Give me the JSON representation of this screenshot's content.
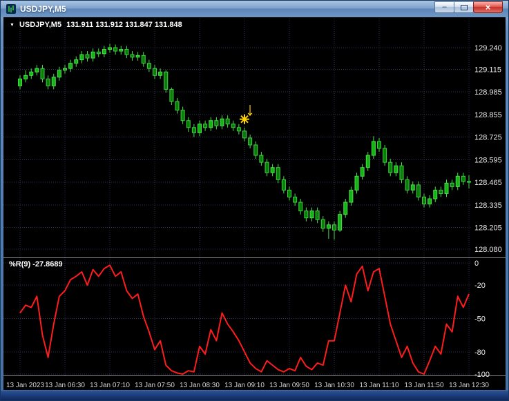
{
  "window": {
    "title": "USDJPY,M5",
    "controls": {
      "minimize_glyph": "–",
      "close_glyph": "×"
    }
  },
  "chart_data": {
    "type": "candlestick",
    "symbol": "USDJPY",
    "timeframe": "M5",
    "header": {
      "collapser_glyph": "▼",
      "symbol_period": "USDJPY,M5",
      "ohlc": "131.911 131.912 131.847 131.848"
    },
    "colors": {
      "background": "#000000",
      "grid": "#32325a",
      "candle_up": "#16b216",
      "candle_down": "#0b7d0b",
      "candle_outline": "#4ade4a",
      "indicator_line": "#ff1c1c",
      "annotation": "#ffd400"
    },
    "price_ticks": [
      129.24,
      129.115,
      128.985,
      128.855,
      128.725,
      128.595,
      128.465,
      128.335,
      128.205,
      128.08
    ],
    "time_labels": [
      {
        "text": "13 Jan 2023",
        "bar": 0
      },
      {
        "text": "13 Jan 06:30",
        "bar": 8
      },
      {
        "text": "13 Jan 07:10",
        "bar": 16
      },
      {
        "text": "13 Jan 07:50",
        "bar": 24
      },
      {
        "text": "13 Jan 08:30",
        "bar": 32
      },
      {
        "text": "13 Jan 09:10",
        "bar": 40
      },
      {
        "text": "13 Jan 09:50",
        "bar": 48
      },
      {
        "text": "13 Jan 10:30",
        "bar": 56
      },
      {
        "text": "13 Jan 11:10",
        "bar": 64
      },
      {
        "text": "13 Jan 11:50",
        "bar": 72
      },
      {
        "text": "13 Jan 12:30",
        "bar": 80
      }
    ],
    "candles": [
      [
        129.02,
        129.08,
        129.0,
        129.06
      ],
      [
        129.06,
        129.11,
        129.04,
        129.08
      ],
      [
        129.08,
        129.12,
        129.06,
        129.1
      ],
      [
        129.1,
        129.14,
        129.08,
        129.12
      ],
      [
        129.12,
        129.14,
        129.04,
        129.06
      ],
      [
        129.06,
        129.08,
        129.0,
        129.02
      ],
      [
        129.02,
        129.09,
        129.0,
        129.07
      ],
      [
        129.07,
        129.13,
        129.05,
        129.11
      ],
      [
        129.11,
        129.14,
        129.09,
        129.12
      ],
      [
        129.12,
        129.17,
        129.1,
        129.15
      ],
      [
        129.15,
        129.19,
        129.13,
        129.17
      ],
      [
        129.17,
        129.22,
        129.15,
        129.2
      ],
      [
        129.2,
        129.22,
        129.16,
        129.18
      ],
      [
        129.18,
        129.235,
        129.16,
        129.215
      ],
      [
        129.215,
        129.235,
        129.185,
        129.205
      ],
      [
        129.205,
        129.25,
        129.185,
        129.23
      ],
      [
        129.23,
        129.262,
        129.21,
        129.24
      ],
      [
        129.24,
        129.258,
        129.2,
        129.22
      ],
      [
        129.22,
        129.25,
        129.2,
        129.23
      ],
      [
        129.23,
        129.25,
        129.18,
        129.2
      ],
      [
        129.2,
        129.22,
        129.165,
        129.185
      ],
      [
        129.185,
        129.215,
        129.165,
        129.195
      ],
      [
        129.195,
        129.215,
        129.13,
        129.15
      ],
      [
        129.15,
        129.17,
        129.1,
        129.12
      ],
      [
        129.12,
        129.14,
        129.06,
        129.08
      ],
      [
        129.08,
        129.12,
        129.06,
        129.1
      ],
      [
        129.1,
        129.11,
        128.98,
        129.0
      ],
      [
        129.0,
        129.01,
        128.91,
        128.93
      ],
      [
        128.93,
        128.95,
        128.86,
        128.88
      ],
      [
        128.88,
        128.9,
        128.8,
        128.82
      ],
      [
        128.82,
        128.84,
        128.755,
        128.78
      ],
      [
        128.78,
        128.8,
        128.725,
        128.75
      ],
      [
        128.75,
        128.82,
        128.73,
        128.8
      ],
      [
        128.8,
        128.82,
        128.76,
        128.78
      ],
      [
        128.78,
        128.84,
        128.76,
        128.82
      ],
      [
        128.82,
        128.84,
        128.77,
        128.79
      ],
      [
        128.79,
        128.85,
        128.77,
        128.83
      ],
      [
        128.83,
        128.85,
        128.78,
        128.8
      ],
      [
        128.8,
        128.82,
        128.76,
        128.78
      ],
      [
        128.78,
        128.8,
        128.74,
        128.76
      ],
      [
        128.76,
        128.78,
        128.7,
        128.72
      ],
      [
        128.72,
        128.74,
        128.66,
        128.68
      ],
      [
        128.68,
        128.7,
        128.6,
        128.62
      ],
      [
        128.62,
        128.64,
        128.56,
        128.58
      ],
      [
        128.58,
        128.6,
        128.5,
        128.52
      ],
      [
        128.52,
        128.57,
        128.5,
        128.55
      ],
      [
        128.55,
        128.57,
        128.46,
        128.48
      ],
      [
        128.48,
        128.5,
        128.4,
        128.42
      ],
      [
        128.42,
        128.44,
        128.36,
        128.38
      ],
      [
        128.38,
        128.4,
        128.33,
        128.35
      ],
      [
        128.35,
        128.37,
        128.28,
        128.3
      ],
      [
        128.3,
        128.32,
        128.24,
        128.26
      ],
      [
        128.26,
        128.32,
        128.24,
        128.3
      ],
      [
        128.3,
        128.32,
        128.23,
        128.25
      ],
      [
        128.25,
        128.27,
        128.18,
        128.2
      ],
      [
        128.2,
        128.24,
        128.14,
        128.22
      ],
      [
        128.22,
        128.24,
        128.135,
        128.19
      ],
      [
        128.19,
        128.3,
        128.18,
        128.28
      ],
      [
        128.28,
        128.37,
        128.26,
        128.35
      ],
      [
        128.35,
        128.44,
        128.33,
        128.42
      ],
      [
        128.42,
        128.52,
        128.4,
        128.5
      ],
      [
        128.5,
        128.57,
        128.48,
        128.55
      ],
      [
        128.55,
        128.64,
        128.53,
        128.62
      ],
      [
        128.62,
        128.73,
        128.6,
        128.7
      ],
      [
        128.7,
        128.72,
        128.64,
        128.66
      ],
      [
        128.66,
        128.68,
        128.56,
        128.58
      ],
      [
        128.58,
        128.6,
        128.5,
        128.52
      ],
      [
        128.52,
        128.58,
        128.5,
        128.56
      ],
      [
        128.56,
        128.58,
        128.46,
        128.48
      ],
      [
        128.48,
        128.5,
        128.4,
        128.42
      ],
      [
        128.42,
        128.47,
        128.4,
        128.45
      ],
      [
        128.45,
        128.47,
        128.36,
        128.38
      ],
      [
        128.38,
        128.4,
        128.32,
        128.34
      ],
      [
        128.34,
        128.39,
        128.32,
        128.37
      ],
      [
        128.37,
        128.44,
        128.35,
        128.42
      ],
      [
        128.42,
        128.44,
        128.38,
        128.4
      ],
      [
        128.4,
        128.48,
        128.38,
        128.46
      ],
      [
        128.46,
        128.48,
        128.42,
        128.44
      ],
      [
        128.44,
        128.52,
        128.42,
        128.5
      ],
      [
        128.5,
        128.52,
        128.45,
        128.47
      ],
      [
        128.47,
        128.505,
        128.43,
        128.465
      ]
    ],
    "annotations": [
      {
        "type": "arrow-down",
        "bar": 41,
        "price": 128.85
      },
      {
        "type": "star",
        "bar": 40,
        "price": 128.828
      }
    ],
    "indicator": {
      "name": "Williams %R",
      "label": "%R(9) -27.8689",
      "ticks": [
        0,
        -20,
        -50,
        -80,
        -100
      ],
      "range": [
        0,
        -100
      ],
      "values": [
        -45,
        -38,
        -40,
        -30,
        -65,
        -85,
        -55,
        -30,
        -25,
        -15,
        -12,
        -8,
        -20,
        -6,
        -12,
        -5,
        -2,
        -12,
        -8,
        -25,
        -32,
        -28,
        -48,
        -62,
        -78,
        -70,
        -92,
        -97,
        -99,
        -100,
        -97,
        -98,
        -75,
        -82,
        -60,
        -70,
        -45,
        -55,
        -62,
        -70,
        -80,
        -90,
        -95,
        -98,
        -88,
        -92,
        -96,
        -98,
        -95,
        -97,
        -85,
        -93,
        -96,
        -90,
        -92,
        -70,
        -70,
        -45,
        -20,
        -35,
        -10,
        -3,
        -25,
        -8,
        -5,
        -30,
        -55,
        -70,
        -85,
        -75,
        -90,
        -98,
        -100,
        -88,
        -75,
        -82,
        -55,
        -62,
        -30,
        -40,
        -27.8689
      ]
    }
  }
}
